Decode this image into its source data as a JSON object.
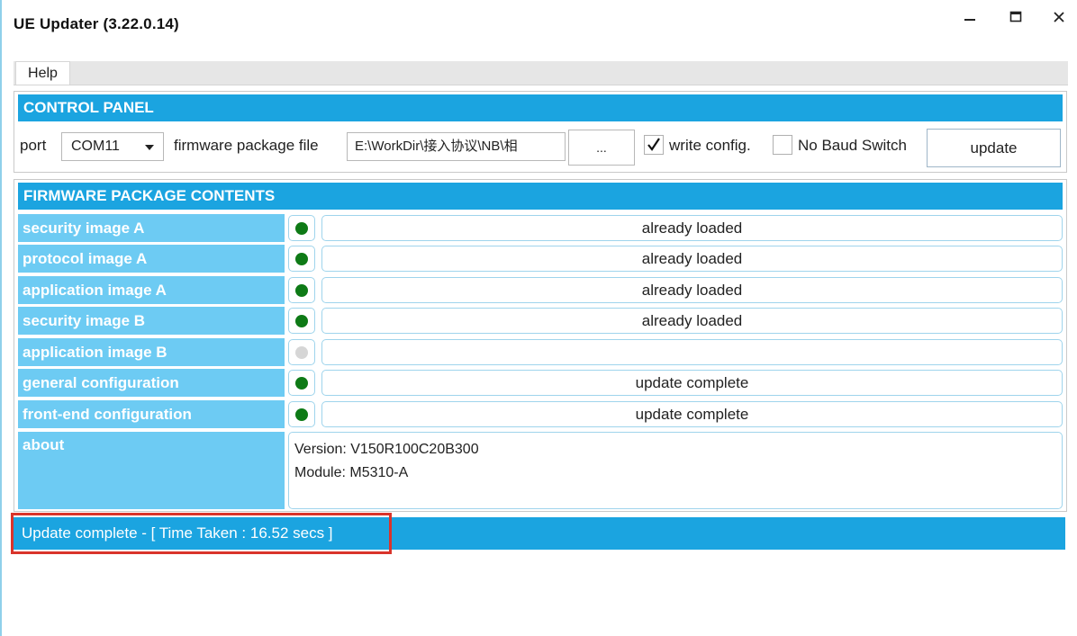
{
  "window": {
    "title": "UE Updater (3.22.0.14)",
    "controls": [
      "minimize-icon",
      "maximize-icon",
      "close-icon"
    ]
  },
  "menu": {
    "items": [
      "Help"
    ]
  },
  "control_panel": {
    "header": "CONTROL PANEL",
    "port_label": "port",
    "port_value": "COM11",
    "firmware_label": "firmware package file",
    "firmware_path": "E:\\WorkDir\\接入协议\\NB\\相",
    "browse_label": "...",
    "write_config_label": "write config.",
    "write_config_checked": true,
    "no_baud_label": "No Baud Switch",
    "no_baud_checked": false,
    "update_label": "update"
  },
  "firmware": {
    "header": "FIRMWARE PACKAGE CONTENTS",
    "rows": [
      {
        "label": "security image A",
        "loaded": true,
        "status": "already loaded"
      },
      {
        "label": "protocol image A",
        "loaded": true,
        "status": "already loaded"
      },
      {
        "label": "application image A",
        "loaded": true,
        "status": "already loaded"
      },
      {
        "label": "security image B",
        "loaded": true,
        "status": "already loaded"
      },
      {
        "label": "application image B",
        "loaded": false,
        "status": ""
      },
      {
        "label": "general configuration",
        "loaded": true,
        "status": "update complete"
      },
      {
        "label": "front-end configuration",
        "loaded": true,
        "status": "update complete"
      }
    ],
    "about_label": "about",
    "about_lines": [
      "Version: V150R100C20B300",
      "Module: M5310-A"
    ]
  },
  "status": {
    "text": "Update complete - [ Time Taken : 16.52 secs ]"
  },
  "colors": {
    "accent": "#1ba4e0",
    "label_bg": "#6dcbf3",
    "loaded_dot": "#0e7a16",
    "empty_dot": "#d6d6d6",
    "highlight": "#d9342b"
  }
}
